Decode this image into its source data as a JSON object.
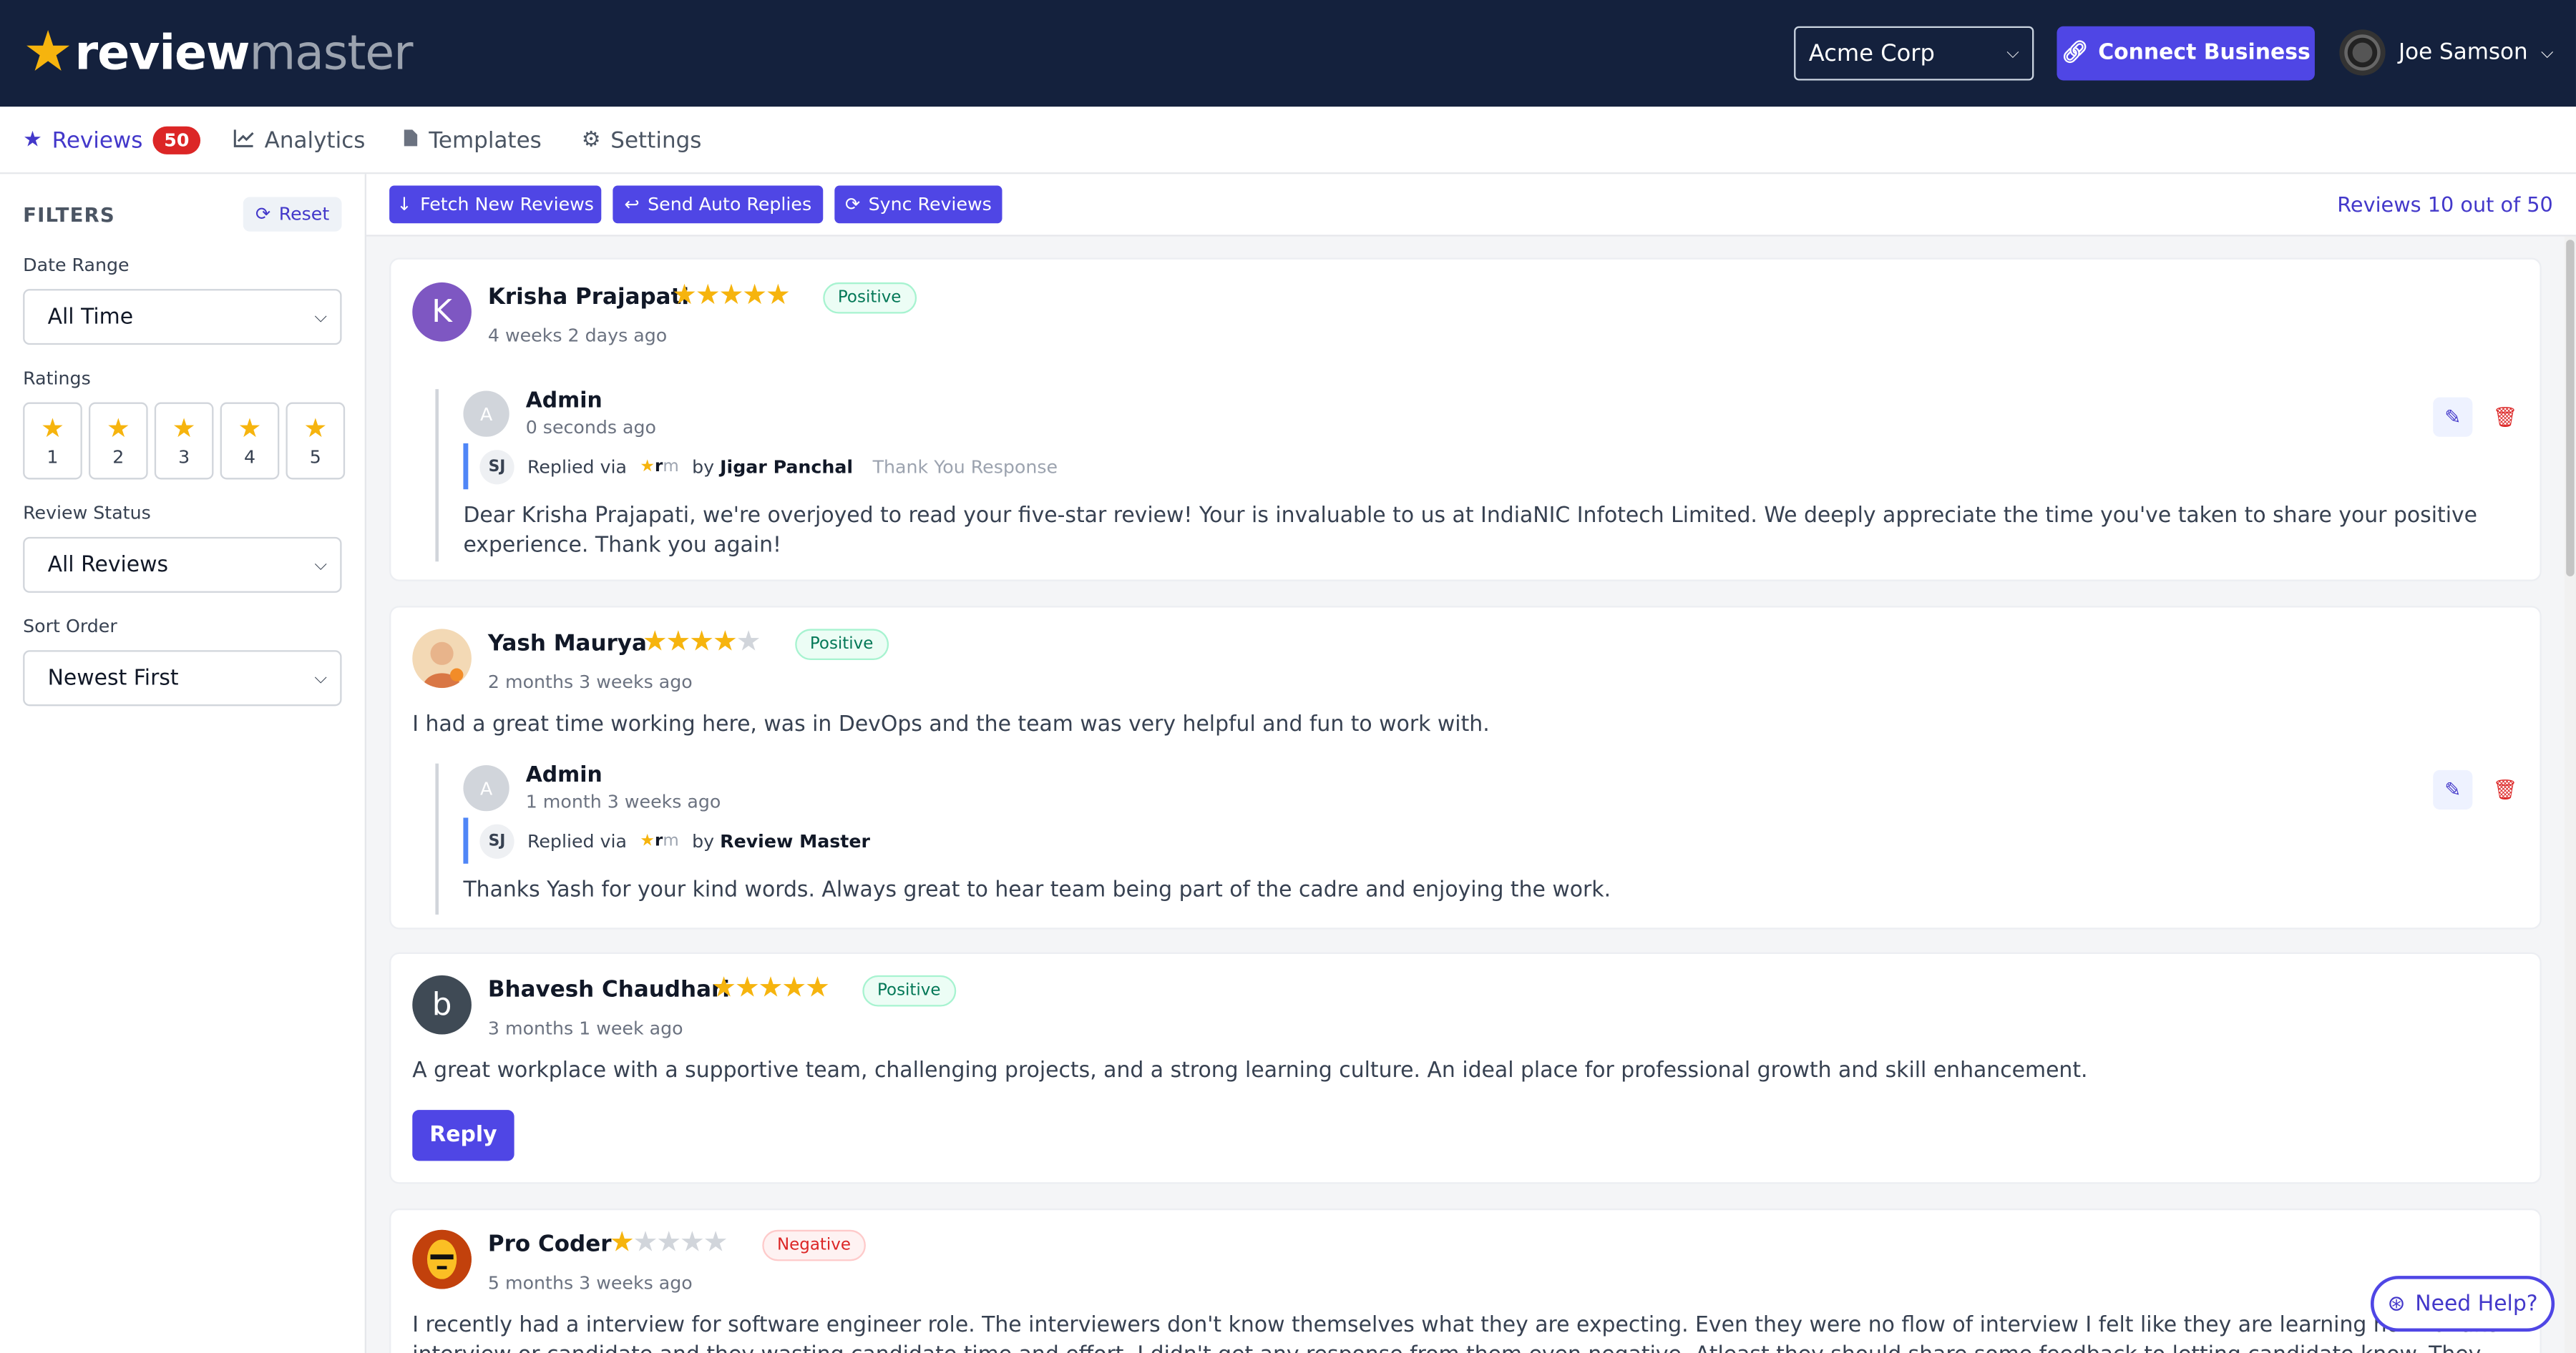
{
  "app": {
    "logo_main": "review",
    "logo_sub": "master",
    "org": "Acme Corp",
    "connect_label": "Connect Business",
    "user_name": "Joe Samson"
  },
  "tabs": [
    {
      "label": "Reviews",
      "badge": "50",
      "icon": "star-icon"
    },
    {
      "label": "Analytics",
      "icon": "chart-line-icon"
    },
    {
      "label": "Templates",
      "icon": "file-icon"
    },
    {
      "label": "Settings",
      "icon": "gear-icon"
    }
  ],
  "filters": {
    "title": "FILTERS",
    "reset_label": "Reset",
    "date_range_label": "Date Range",
    "date_range_value": "All Time",
    "ratings_label": "Ratings",
    "ratings": [
      "1",
      "2",
      "3",
      "4",
      "5"
    ],
    "status_label": "Review Status",
    "status_value": "All Reviews",
    "sort_label": "Sort Order",
    "sort_value": "Newest First"
  },
  "toolbar": {
    "fetch_label": "Fetch New Reviews",
    "auto_label": "Send Auto Replies",
    "sync_label": "Sync Reviews",
    "count_text": "Reviews 10 out of 50"
  },
  "reviews": [
    {
      "initial": "K",
      "avatar_color": "#7e57c2",
      "name": "Krisha Prajapati",
      "rating": 5,
      "sentiment": "Positive",
      "time": "4 weeks 2 days ago",
      "reply": {
        "admin_initial": "A",
        "admin_name": "Admin",
        "time": "0 seconds ago",
        "sj": "SJ",
        "via_text": "Replied via",
        "by_text": "by",
        "by_name": "Jigar Panchal",
        "type": "Thank You Response",
        "text": "Dear Krisha Prajapati, we're overjoyed to read your five-star review! Your is invaluable to us at IndiaNIC Infotech Limited. We deeply appreciate the time you've taken to share your positive experience. Thank you again!"
      }
    },
    {
      "initial": "",
      "avatar_color": "#f3d9b5",
      "name": "Yash Maurya",
      "rating": 4,
      "sentiment": "Positive",
      "time": "2 months 3 weeks ago",
      "text": "I had a great time working here, was in DevOps and the team was very helpful and fun to work with.",
      "reply": {
        "admin_initial": "A",
        "admin_name": "Admin",
        "time": "1 month 3 weeks ago",
        "sj": "SJ",
        "via_text": "Replied via",
        "by_text": "by",
        "by_name": "Review Master",
        "text": "Thanks Yash for your kind words. Always great to hear team being part of the cadre and enjoying the work."
      }
    },
    {
      "initial": "b",
      "avatar_color": "#3f4a55",
      "name": "Bhavesh Chaudhari",
      "rating": 5,
      "sentiment": "Positive",
      "time": "3 months 1 week ago",
      "text": "A great workplace with a supportive team, challenging projects, and a strong learning culture. An ideal place for professional growth and skill enhancement.",
      "reply_label": "Reply"
    },
    {
      "initial": "",
      "avatar_color": "#b23a14",
      "name": "Pro Coder",
      "rating": 1,
      "sentiment": "Negative",
      "time": "5 months 3 weeks ago",
      "text": "I recently had a interview for software engineer role. The interviewers don't know themselves what they are expecting. Even they were no flow of interview I felt like they are learning how to take interview or candidate and they wasting candidate time and effort. I didn't get any response from them even negative. Atleast they should share some feedback to letting candidate know. They are silently ignoring us."
    }
  ],
  "help_label": "Need Help?",
  "colors": {
    "header_bg": "#14213d",
    "accent": "#4f46e5",
    "star": "#f6b40e",
    "badge": "#dc2626"
  }
}
